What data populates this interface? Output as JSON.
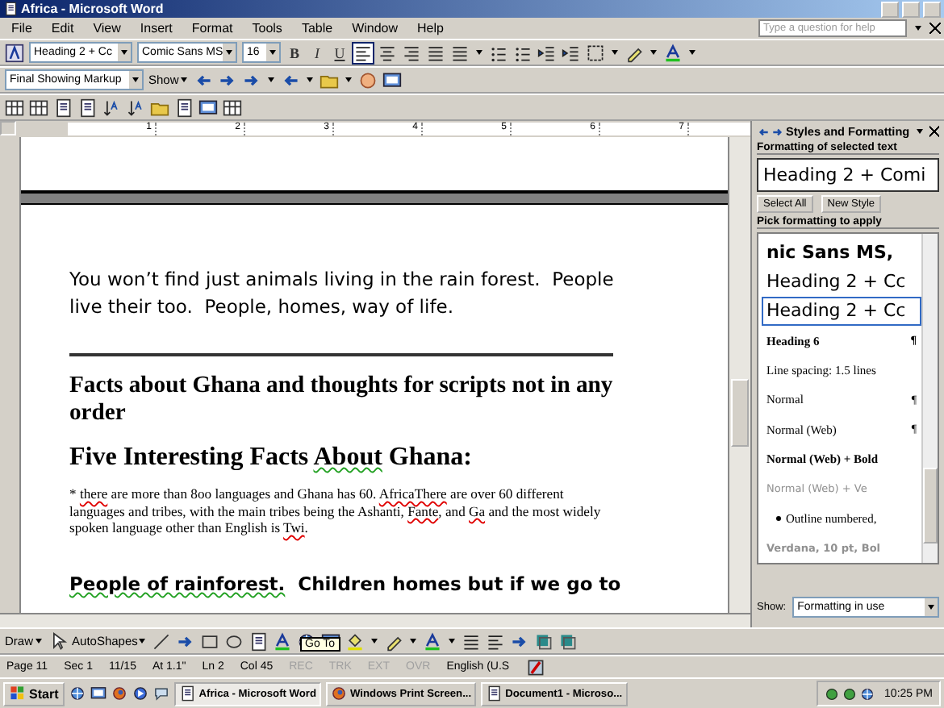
{
  "window": {
    "title": "Africa - Microsoft Word"
  },
  "menu": [
    {
      "label": "File"
    },
    {
      "label": "Edit"
    },
    {
      "label": "View"
    },
    {
      "label": "Insert"
    },
    {
      "label": "Format"
    },
    {
      "label": "Tools"
    },
    {
      "label": "Table"
    },
    {
      "label": "Window"
    },
    {
      "label": "Help"
    }
  ],
  "help_box": {
    "placeholder": "Type a question for help"
  },
  "formatting_toolbar": {
    "style": "Heading 2 + Cc",
    "font": "Comic Sans MS",
    "size": "16",
    "bold": "B",
    "italic": "I",
    "underline": "U",
    "alignment": [
      {
        "selected": true
      },
      {
        "selected": false
      },
      {
        "selected": false
      },
      {
        "selected": false
      }
    ]
  },
  "reviewing_toolbar": {
    "display": "Final Showing Markup",
    "show": "Show"
  },
  "ruler": {
    "labels": [
      "1",
      "2",
      "3",
      "4",
      "5",
      "6",
      "7"
    ]
  },
  "document": {
    "blocks": [
      {
        "kind": "comic",
        "runs": [
          {
            "text": "You won’t find just animals living in the rain forest.  People live their too.  People, homes, way of life."
          }
        ]
      },
      {
        "kind": "rule"
      },
      {
        "kind": "heading1",
        "runs": [
          {
            "text": "Facts about Ghana and thoughts for scripts not in any order"
          }
        ]
      },
      {
        "kind": "heading2",
        "runs": [
          {
            "text": "Five Interesting Facts "
          },
          {
            "text": "About",
            "grammar_flag": true
          },
          {
            "text": " Ghana:"
          }
        ]
      },
      {
        "kind": "small",
        "runs": [
          {
            "text": "* "
          },
          {
            "text": "there",
            "misspelled": true
          },
          {
            "text": " are more than 8oo languages and Ghana has 60. "
          },
          {
            "text": "AfricaThere",
            "misspelled": true
          },
          {
            "text": " are over 60 different languages and tribes, with the main tribes being the Ashanti, "
          },
          {
            "text": "Fante",
            "misspelled": true
          },
          {
            "text": ", and "
          },
          {
            "text": "Ga",
            "misspelled": true
          },
          {
            "text": " and the most widely spoken language other than English is "
          },
          {
            "text": "Twi",
            "misspelled": true
          },
          {
            "text": "."
          }
        ]
      },
      {
        "kind": "comic-bold",
        "runs": [
          {
            "text": "People of rainforest.",
            "grammar_flag": true
          },
          {
            "text": "  Children homes but if we go to"
          }
        ]
      }
    ]
  },
  "task_pane": {
    "title": "Styles and Formatting",
    "selected_label": "Formatting of selected text",
    "selected_format": "Heading 2 + Comi",
    "buttons": [
      {
        "label": "Select All"
      },
      {
        "label": "New Style"
      }
    ],
    "pick_label": "Pick formatting to apply",
    "styles": [
      {
        "text": "nic Sans MS,",
        "kind": "large-bold",
        "selected": false
      },
      {
        "text": "Heading 2 + Cc",
        "kind": "large",
        "selected": false
      },
      {
        "text": "Heading 2 + Cc",
        "kind": "large",
        "selected": true
      },
      {
        "text": "Heading 6",
        "kind": "serif-bold",
        "selected": false,
        "mark": "¶"
      },
      {
        "text": "Line spacing:  1.5 lines",
        "kind": "serif",
        "selected": false
      },
      {
        "text": "Normal",
        "kind": "serif",
        "selected": false,
        "mark": "¶"
      },
      {
        "text": "Normal (Web)",
        "kind": "serif",
        "selected": false,
        "mark": "¶"
      },
      {
        "text": "Normal (Web) + Bold",
        "kind": "serif-bold",
        "selected": false
      },
      {
        "text": "Normal (Web) + Ve",
        "kind": "grey-sans",
        "selected": false
      },
      {
        "text": "Outline numbered,",
        "kind": "bullet",
        "selected": false
      },
      {
        "text": "Verdana, 10 pt, Bol",
        "kind": "grey-sans-bold",
        "selected": false
      }
    ],
    "show_label": "Show:",
    "show_value": "Formatting in use"
  },
  "drawing_toolbar": {
    "draw": "Draw",
    "autoshapes": "AutoShapes",
    "tooltip": "Go To"
  },
  "status_bar": [
    {
      "text": "Page 11",
      "disabled": false
    },
    {
      "text": "Sec 1",
      "disabled": false
    },
    {
      "text": "11/15",
      "disabled": false
    },
    {
      "text": "At 1.1\"",
      "disabled": false
    },
    {
      "text": "Ln 2",
      "disabled": false
    },
    {
      "text": "Col 45",
      "disabled": false
    },
    {
      "text": "REC",
      "disabled": true
    },
    {
      "text": "TRK",
      "disabled": true
    },
    {
      "text": "EXT",
      "disabled": true
    },
    {
      "text": "OVR",
      "disabled": true
    },
    {
      "text": "English (U.S",
      "disabled": false
    }
  ],
  "taskbar": {
    "start": "Start",
    "tasks": [
      {
        "label": "Africa - Microsoft Word",
        "selected": true
      },
      {
        "label": "Windows Print Screen...",
        "selected": false
      },
      {
        "label": "Document1 - Microso...",
        "selected": false
      }
    ],
    "clock": "10:25 PM"
  }
}
